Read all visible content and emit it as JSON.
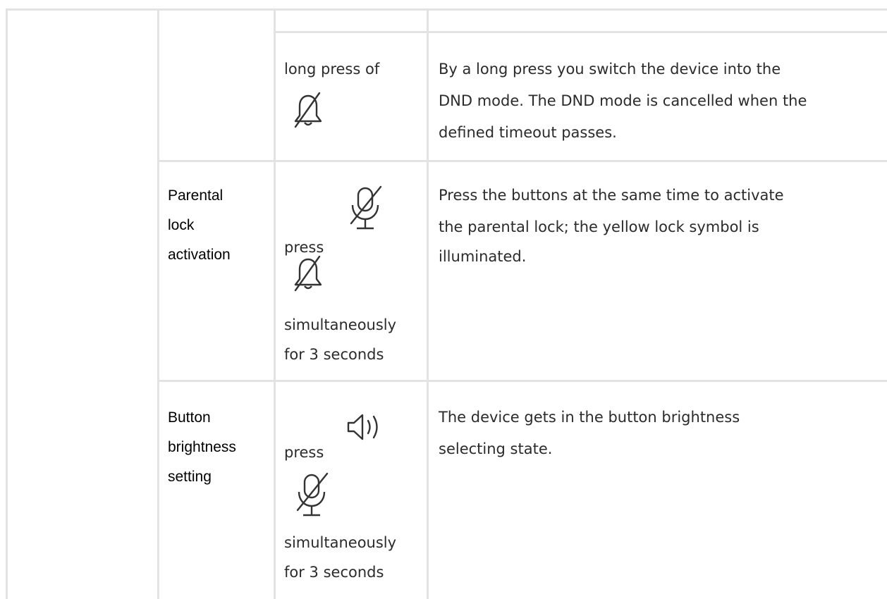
{
  "rows": [
    {
      "feature": [],
      "action": {
        "before": "long press of",
        "icons": [
          "bell-slash-icon"
        ],
        "after": []
      },
      "description": [
        "By a long press you switch the device into the",
        "DND mode. The DND mode is cancelled when the",
        "defined timeout passes."
      ]
    },
    {
      "feature": [
        "Parental",
        "lock",
        "activation"
      ],
      "action": {
        "before": "press",
        "icons": [
          "microphone-slash-icon",
          "bell-slash-icon"
        ],
        "after": [
          "simultaneously",
          "for 3 seconds"
        ]
      },
      "description": [
        "Press the buttons at the same time to activate",
        "the parental lock; the yellow lock symbol is",
        "illuminated."
      ]
    },
    {
      "feature": [
        "Button",
        "brightness",
        "setting"
      ],
      "action": {
        "before": "press",
        "icons": [
          "speaker-icon",
          "microphone-slash-icon"
        ],
        "after": [
          "simultaneously",
          "for 3 seconds"
        ]
      },
      "description": [
        "The device gets in the button brightness",
        "selecting state."
      ]
    }
  ]
}
